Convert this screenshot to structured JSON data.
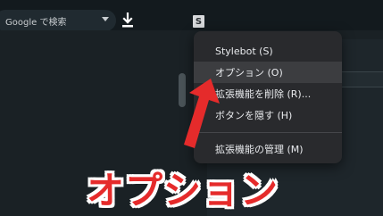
{
  "toolbar": {
    "search_label": "Google で検索",
    "extension_badge": "S"
  },
  "context_menu": {
    "items": [
      {
        "label": "Stylebot (S)",
        "highlighted": false
      },
      {
        "label": "オプション (O)",
        "highlighted": true
      },
      {
        "label": "拡張機能を削除 (R)...",
        "highlighted": false
      },
      {
        "label": "ボタンを隠す (H)",
        "highlighted": false
      },
      {
        "label": "拡張機能の管理 (M)",
        "highlighted": false
      }
    ]
  },
  "annotation": {
    "caption": "オプション",
    "caption_color": "#e52b2b",
    "arrow_color": "#e52b2b"
  },
  "colors": {
    "background": "#1b2227",
    "menu_background": "#292a2d",
    "menu_highlight": "#3c3d40"
  }
}
